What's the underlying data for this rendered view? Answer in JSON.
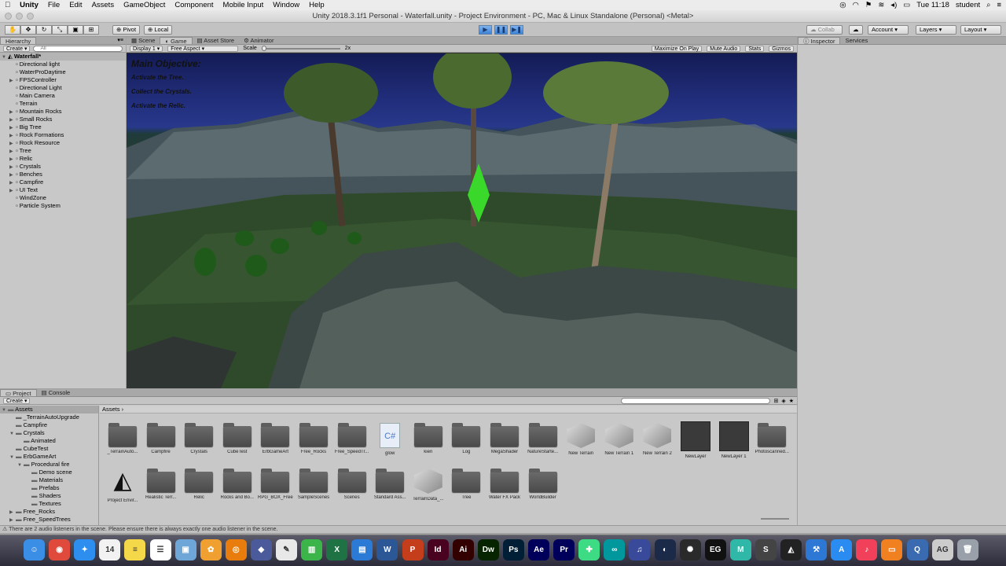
{
  "menubar": {
    "app": "Unity",
    "items": [
      "File",
      "Edit",
      "Assets",
      "GameObject",
      "Component",
      "Mobile Input",
      "Window",
      "Help"
    ],
    "clock": "Tue 11:18",
    "user": "student"
  },
  "window": {
    "title": "Unity 2018.3.1f1 Personal - Waterfall.unity - Project Environment - PC, Mac & Linux Standalone (Personal) <Metal>"
  },
  "toolbar": {
    "pivot": "Pivot",
    "local": "Local",
    "collab": "Collab",
    "account": "Account",
    "layers": "Layers",
    "layout": "Layout"
  },
  "hierarchy": {
    "tab": "Hierarchy",
    "create": "Create",
    "search_placeholder": "All",
    "scene": "Waterfall*",
    "items": [
      {
        "label": "Directional light",
        "arrow": ""
      },
      {
        "label": "WaterProDaytime",
        "arrow": ""
      },
      {
        "label": "FPSController",
        "arrow": "▶"
      },
      {
        "label": "Directional Light",
        "arrow": ""
      },
      {
        "label": "Main Camera",
        "arrow": ""
      },
      {
        "label": "Terrain",
        "arrow": ""
      },
      {
        "label": "Mountain Rocks",
        "arrow": "▶"
      },
      {
        "label": "Small Rocks",
        "arrow": "▶"
      },
      {
        "label": "Big Tree",
        "arrow": "▶"
      },
      {
        "label": "Rock Formations",
        "arrow": "▶"
      },
      {
        "label": "Rock Resource",
        "arrow": "▶"
      },
      {
        "label": "Tree",
        "arrow": "▶"
      },
      {
        "label": "Relic",
        "arrow": "▶"
      },
      {
        "label": "Crystals",
        "arrow": "▶"
      },
      {
        "label": "Benches",
        "arrow": "▶"
      },
      {
        "label": "Campfire",
        "arrow": "▶"
      },
      {
        "label": "UI Text",
        "arrow": "▶"
      },
      {
        "label": "WindZone",
        "arrow": ""
      },
      {
        "label": "Particle System",
        "arrow": ""
      }
    ]
  },
  "game": {
    "tabs": [
      "Scene",
      "Game",
      "Asset Store",
      "Animator"
    ],
    "display": "Display 1",
    "aspect": "Free Aspect",
    "scale_label": "Scale",
    "scale_value": "2x",
    "options": [
      "Maximize On Play",
      "Mute Audio",
      "Stats",
      "Gizmos"
    ],
    "objective": {
      "title": "Main Objective:",
      "lines": [
        "Activate the Tree.",
        "Collect the Crystals.",
        "Activate the Relic."
      ]
    }
  },
  "inspector": {
    "tabs": [
      "Inspector",
      "Services"
    ]
  },
  "project": {
    "tabs": [
      "Project",
      "Console"
    ],
    "create": "Create",
    "breadcrumb": "Assets",
    "tree": [
      {
        "label": "Assets",
        "indent": 0,
        "arrow": "▼",
        "sel": true
      },
      {
        "label": "_TerrainAutoUpgrade",
        "indent": 1,
        "arrow": ""
      },
      {
        "label": "Campfire",
        "indent": 1,
        "arrow": ""
      },
      {
        "label": "Crystals",
        "indent": 1,
        "arrow": "▼"
      },
      {
        "label": "Animated",
        "indent": 2,
        "arrow": ""
      },
      {
        "label": "CubeTest",
        "indent": 1,
        "arrow": ""
      },
      {
        "label": "ErbGameArt",
        "indent": 1,
        "arrow": "▼"
      },
      {
        "label": "Procedural fire",
        "indent": 2,
        "arrow": "▼"
      },
      {
        "label": "Demo scene",
        "indent": 3,
        "arrow": ""
      },
      {
        "label": "Materials",
        "indent": 3,
        "arrow": ""
      },
      {
        "label": "Prefabs",
        "indent": 3,
        "arrow": ""
      },
      {
        "label": "Shaders",
        "indent": 3,
        "arrow": ""
      },
      {
        "label": "Textures",
        "indent": 3,
        "arrow": ""
      },
      {
        "label": "Free_Rocks",
        "indent": 1,
        "arrow": "▶"
      },
      {
        "label": "Free_SpeedTrees",
        "indent": 1,
        "arrow": "▶"
      }
    ],
    "row1": [
      {
        "label": "_TerrainAuto...",
        "kind": "folder"
      },
      {
        "label": "Campfire",
        "kind": "folder"
      },
      {
        "label": "Crystals",
        "kind": "folder"
      },
      {
        "label": "CubeTest",
        "kind": "folder"
      },
      {
        "label": "ErbGameArt",
        "kind": "folder"
      },
      {
        "label": "Free_Rocks",
        "kind": "folder"
      },
      {
        "label": "Free_SpeedTr...",
        "kind": "folder"
      },
      {
        "label": "glow",
        "kind": "script"
      },
      {
        "label": "kien",
        "kind": "folder"
      },
      {
        "label": "Log",
        "kind": "folder"
      },
      {
        "label": "MegaShader",
        "kind": "folder"
      },
      {
        "label": "NatureStarte...",
        "kind": "folder"
      },
      {
        "label": "New Terrain",
        "kind": "terrain"
      },
      {
        "label": "New Terrain 1",
        "kind": "terrain"
      },
      {
        "label": "New Terrain 2",
        "kind": "terrain"
      },
      {
        "label": "NewLayer",
        "kind": "dark"
      },
      {
        "label": "NewLayer 1",
        "kind": "dark"
      },
      {
        "label": "Photoscanned...",
        "kind": "folder"
      }
    ],
    "row2": [
      {
        "label": "Project Envir...",
        "kind": "unity"
      },
      {
        "label": "Realistic Terr...",
        "kind": "folder"
      },
      {
        "label": "Relic",
        "kind": "folder"
      },
      {
        "label": "Rocks and Bo...",
        "kind": "folder"
      },
      {
        "label": "RPG_BOX_Free",
        "kind": "folder"
      },
      {
        "label": "SampleScenes",
        "kind": "folder"
      },
      {
        "label": "Scenes",
        "kind": "folder"
      },
      {
        "label": "Standard Ass...",
        "kind": "folder"
      },
      {
        "label": "TerrainData_...",
        "kind": "terrain"
      },
      {
        "label": "Tree",
        "kind": "folder"
      },
      {
        "label": "Water FX Pack",
        "kind": "folder"
      },
      {
        "label": "WorldBuilder",
        "kind": "folder"
      }
    ]
  },
  "status": {
    "text": "There are 2 audio listeners in the scene. Please ensure there is always exactly one audio listener in the scene."
  },
  "dock": {
    "apps": [
      {
        "name": "finder-icon",
        "glyph": "☺",
        "color": "#3a8ee6"
      },
      {
        "name": "chrome-icon",
        "glyph": "◉",
        "color": "#e04a3c"
      },
      {
        "name": "safari-icon",
        "glyph": "✦",
        "color": "#2d8ef0"
      },
      {
        "name": "calendar-icon",
        "glyph": "14",
        "color": "#f2f2f2"
      },
      {
        "name": "notes-icon",
        "glyph": "≡",
        "color": "#f5d74a"
      },
      {
        "name": "reminders-icon",
        "glyph": "☰",
        "color": "#ffffff"
      },
      {
        "name": "preview-icon",
        "glyph": "▣",
        "color": "#6fa6d8"
      },
      {
        "name": "photos-icon",
        "glyph": "✿",
        "color": "#f0a030"
      },
      {
        "name": "blender-icon",
        "glyph": "◎",
        "color": "#e87d0d"
      },
      {
        "name": "vectorworks-icon",
        "glyph": "◆",
        "color": "#4a5a9a"
      },
      {
        "name": "textedit-icon",
        "glyph": "✎",
        "color": "#e8e8e8"
      },
      {
        "name": "numbers-icon",
        "glyph": "▥",
        "color": "#3bb54a"
      },
      {
        "name": "excel-icon",
        "glyph": "X",
        "color": "#1f7244"
      },
      {
        "name": "keynote-icon",
        "glyph": "▤",
        "color": "#2a7ad6"
      },
      {
        "name": "word-icon",
        "glyph": "W",
        "color": "#2b5797"
      },
      {
        "name": "powerpoint-icon",
        "glyph": "P",
        "color": "#c43e1c"
      },
      {
        "name": "indesign-icon",
        "glyph": "Id",
        "color": "#49021f"
      },
      {
        "name": "illustrator-icon",
        "glyph": "Ai",
        "color": "#330000"
      },
      {
        "name": "dreamweaver-icon",
        "glyph": "Dw",
        "color": "#072401"
      },
      {
        "name": "photoshop-icon",
        "glyph": "Ps",
        "color": "#001e36"
      },
      {
        "name": "aftereffects-icon",
        "glyph": "Ae",
        "color": "#00005b"
      },
      {
        "name": "premiere-icon",
        "glyph": "Pr",
        "color": "#00005b"
      },
      {
        "name": "android-studio-icon",
        "glyph": "✚",
        "color": "#3ddc84"
      },
      {
        "name": "arduino-icon",
        "glyph": "∞",
        "color": "#00979d"
      },
      {
        "name": "audio-icon",
        "glyph": "♫",
        "color": "#3a4a9a"
      },
      {
        "name": "cinema4d-icon",
        "glyph": "◐",
        "color": "#1c2a4a"
      },
      {
        "name": "davinci-icon",
        "glyph": "✺",
        "color": "#2a2a2a"
      },
      {
        "name": "epic-games-icon",
        "glyph": "EG",
        "color": "#111111"
      },
      {
        "name": "maya-icon",
        "glyph": "M",
        "color": "#2fb7a8"
      },
      {
        "name": "substance-icon",
        "glyph": "S",
        "color": "#444444"
      },
      {
        "name": "unity-icon",
        "glyph": "◭",
        "color": "#222222"
      },
      {
        "name": "xcode-icon",
        "glyph": "⚒",
        "color": "#2c78d4"
      },
      {
        "name": "app-store-icon",
        "glyph": "A",
        "color": "#2a8cf0"
      },
      {
        "name": "music-icon",
        "glyph": "♪",
        "color": "#f0405a"
      },
      {
        "name": "books-icon",
        "glyph": "▭",
        "color": "#f08020"
      },
      {
        "name": "quicktime-icon",
        "glyph": "Q",
        "color": "#3a6ab0"
      },
      {
        "name": "font-book-icon",
        "glyph": "AG",
        "color": "#cccccc"
      },
      {
        "name": "trash-icon",
        "glyph": "🗑",
        "color": "#9aa0aa"
      }
    ]
  }
}
